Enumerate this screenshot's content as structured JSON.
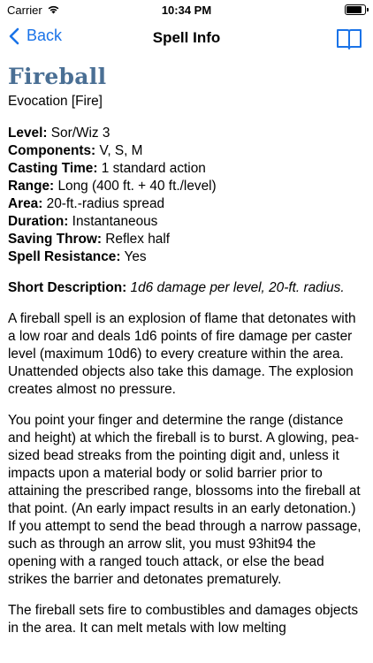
{
  "status_bar": {
    "carrier": "Carrier",
    "time": "10:34 PM",
    "battery_level": 0.9
  },
  "nav": {
    "back_label": "Back",
    "title": "Spell Info",
    "book_icon": "book-icon"
  },
  "spell": {
    "name": "Fireball",
    "school": "Evocation [Fire]",
    "stats": [
      {
        "label": "Level:",
        "value": " Sor/Wiz 3"
      },
      {
        "label": "Components:",
        "value": " V, S, M"
      },
      {
        "label": "Casting Time:",
        "value": " 1 standard action"
      },
      {
        "label": "Range:",
        "value": " Long (400 ft. + 40 ft./level)"
      },
      {
        "label": "Area:",
        "value": " 20-ft.-radius spread"
      },
      {
        "label": "Duration:",
        "value": " Instantaneous"
      },
      {
        "label": "Saving Throw:",
        "value": " Reflex half"
      },
      {
        "label": "Spell Resistance:",
        "value": " Yes"
      }
    ],
    "short_description_label": "Short Description:",
    "short_description": " 1d6 damage per level, 20-ft. radius.",
    "paragraphs": [
      "A fireball spell is an explosion of flame that detonates with a low roar and deals 1d6 points of fire damage per caster level (maximum 10d6) to every creature within the area. Unattended objects also take this damage. The explosion creates almost no pressure.",
      "You point your finger and determine the range (distance and height) at which the fireball is to burst. A glowing, pea-sized bead streaks from the pointing digit and, unless it impacts upon a material body or solid barrier prior to attaining the prescribed range, blossoms into the fireball at that point. (An early impact results in an early detonation.) If you attempt to send the bead through a narrow passage, such as through an arrow slit, you must 93hit94 the opening with a ranged touch attack, or else the bead strikes the barrier and detonates prematurely.",
      "The fireball sets fire to combustibles and damages objects in the area. It can melt metals with low melting"
    ]
  },
  "colors": {
    "accent": "#1a73e8",
    "title": "#4a6f94"
  }
}
